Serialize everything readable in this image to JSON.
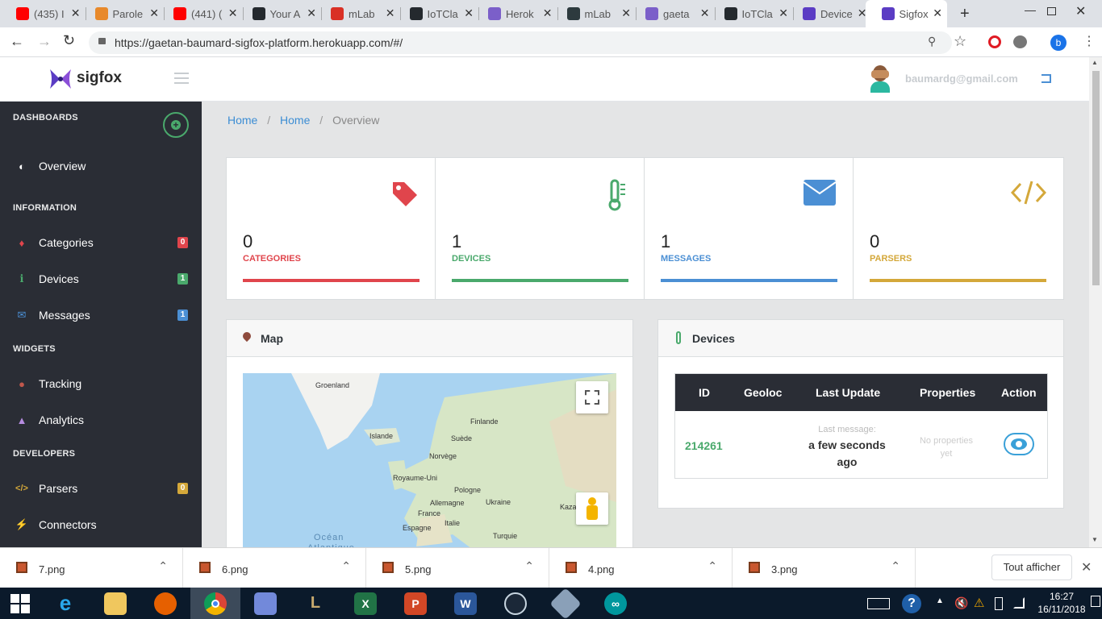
{
  "browser": {
    "tabs": [
      {
        "label": "(435) I",
        "icon": "youtube-icon",
        "color": "#ff0000"
      },
      {
        "label": "Parole",
        "icon": "sun-icon",
        "color": "#e8892b"
      },
      {
        "label": "(441) (",
        "icon": "youtube-icon",
        "color": "#ff0000"
      },
      {
        "label": "Your A",
        "icon": "github-icon",
        "color": "#24292e"
      },
      {
        "label": "mLab",
        "icon": "gmail-icon",
        "color": "#d93025"
      },
      {
        "label": "IoTCla",
        "icon": "github-icon",
        "color": "#24292e"
      },
      {
        "label": "Herok",
        "icon": "heroku-icon",
        "color": "#7b5fc9"
      },
      {
        "label": "mLab",
        "icon": "mlab-icon",
        "color": "#2d3a3e"
      },
      {
        "label": "gaeta",
        "icon": "heroku-icon",
        "color": "#7b5fc9"
      },
      {
        "label": "IoTCla",
        "icon": "github-icon",
        "color": "#24292e"
      },
      {
        "label": "Device",
        "icon": "sigfox-icon",
        "color": "#5b3cc4"
      },
      {
        "label": "Sigfox",
        "icon": "sigfox-icon",
        "color": "#5b3cc4"
      }
    ],
    "url": "https://gaetan-baumard-sigfox-platform.herokuapp.com/#/",
    "profile_initial": "b"
  },
  "app": {
    "logo_text": "sigfox",
    "user_email": "baumardg@gmail.com"
  },
  "sidebar": {
    "sections": {
      "dashboards": "DASHBOARDS",
      "information": "INFORMATION",
      "widgets": "WIDGETS",
      "developers": "DEVELOPERS"
    },
    "items": {
      "overview": {
        "label": "Overview"
      },
      "categories": {
        "label": "Categories",
        "badge": "0",
        "badge_color": "#e0454c"
      },
      "devices": {
        "label": "Devices",
        "badge": "1",
        "badge_color": "#4aa96c"
      },
      "messages": {
        "label": "Messages",
        "badge": "1",
        "badge_color": "#4b8fd4"
      },
      "tracking": {
        "label": "Tracking"
      },
      "analytics": {
        "label": "Analytics"
      },
      "parsers": {
        "label": "Parsers",
        "badge": "0",
        "badge_color": "#d4a83a"
      },
      "connectors": {
        "label": "Connectors"
      }
    }
  },
  "breadcrumb": [
    "Home",
    "Home",
    "Overview"
  ],
  "stats": [
    {
      "value": "0",
      "label": "CATEGORIES",
      "color": "#e0454c",
      "icon": "tag-icon"
    },
    {
      "value": "1",
      "label": "DEVICES",
      "color": "#4aa96c",
      "icon": "thermometer-icon"
    },
    {
      "value": "1",
      "label": "MESSAGES",
      "color": "#4b8fd4",
      "icon": "envelope-icon"
    },
    {
      "value": "0",
      "label": "PARSERS",
      "color": "#d4a83a",
      "icon": "code-icon"
    }
  ],
  "map_panel": {
    "title": "Map",
    "labels": [
      "Groenland",
      "Finlande",
      "Islande",
      "Suède",
      "Norvège",
      "Royaume-Uni",
      "Pologne",
      "Allemagne",
      "Ukraine",
      "France",
      "Kazal",
      "Italie",
      "Espagne",
      "Turquie",
      "Océan",
      "Atlantique"
    ]
  },
  "devices_panel": {
    "title": "Devices",
    "columns": [
      "ID",
      "Geoloc",
      "Last Update",
      "Properties",
      "Action"
    ],
    "rows": [
      {
        "id": "214261",
        "last_update_prefix": "Last message:",
        "last_update": "a few seconds ago",
        "properties": "No properties yet"
      }
    ]
  },
  "downloads": {
    "files": [
      "7.png",
      "6.png",
      "5.png",
      "4.png",
      "3.png"
    ],
    "show_all": "Tout afficher"
  },
  "taskbar": {
    "time": "16:27",
    "date": "16/11/2018"
  }
}
